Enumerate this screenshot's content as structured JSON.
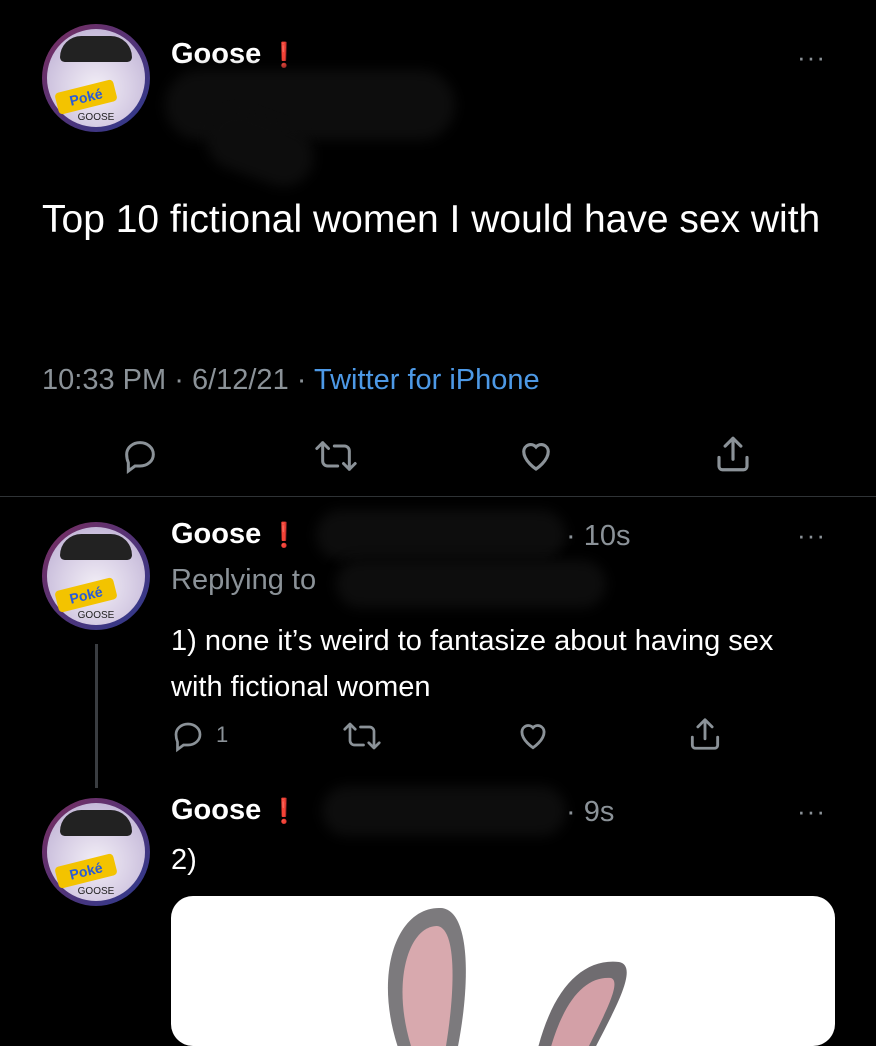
{
  "main_tweet": {
    "display_name": "Goose",
    "verified_mark": "❗",
    "more_label": "···",
    "text": "Top 10 fictional women I would have sex with",
    "time": "10:33 PM",
    "date": "6/12/21",
    "source": "Twitter for iPhone",
    "sep": "·",
    "actions": [
      "reply-icon",
      "retweet-icon",
      "like-icon",
      "share-icon"
    ]
  },
  "reply_1": {
    "display_name": "Goose",
    "verified_mark": "❗",
    "timestamp": "· 10s",
    "replying_to": "Replying to",
    "text": "1) none it’s weird to fantasize about having sex with fictional women",
    "reply_count": "1",
    "more_label": "···"
  },
  "reply_2": {
    "display_name": "Goose",
    "verified_mark": "❗",
    "timestamp": "· 9s",
    "text": "2)",
    "more_label": "···"
  },
  "avatar": {
    "badge_text": "Poké",
    "sub_text": "GOOSE"
  },
  "colors": {
    "background": "#000000",
    "link_blue": "#4d99e6",
    "secondary": "#8b9298",
    "divider": "#2f3336"
  }
}
